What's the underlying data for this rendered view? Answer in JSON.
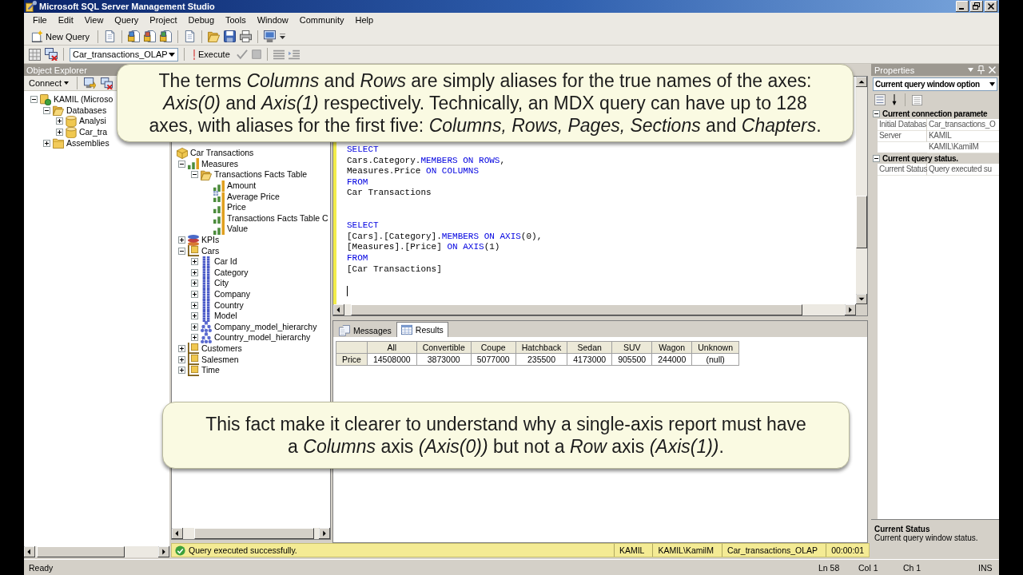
{
  "window": {
    "title": "Microsoft SQL Server Management Studio"
  },
  "menu": [
    "File",
    "Edit",
    "View",
    "Query",
    "Project",
    "Debug",
    "Tools",
    "Window",
    "Community",
    "Help"
  ],
  "toolbar": {
    "new_query": "New Query",
    "database": "Car_transactions_OLAP",
    "execute": "Execute"
  },
  "object_explorer": {
    "title": "Object Explorer",
    "connect": "Connect",
    "tree": [
      {
        "label": "KAMIL (Microso",
        "kind": "server",
        "expanded": true,
        "children": [
          {
            "label": "Databases",
            "kind": "folder",
            "expanded": true,
            "children": [
              {
                "label": "Analysi",
                "kind": "database",
                "expanded": false
              },
              {
                "label": "Car_tra",
                "kind": "database",
                "expanded": false
              }
            ]
          },
          {
            "label": "Assemblies",
            "kind": "folder",
            "expanded": false
          }
        ]
      }
    ]
  },
  "metadata": {
    "cube": "Car Transactions",
    "tree": [
      {
        "label": "Measures",
        "kind": "measures",
        "expanded": true,
        "children": [
          {
            "label": "Transactions Facts Table",
            "kind": "folder",
            "expanded": true,
            "children": [
              {
                "label": "Amount",
                "kind": "measure"
              },
              {
                "label": "Average Price",
                "kind": "calculated"
              },
              {
                "label": "Price",
                "kind": "measure"
              },
              {
                "label": "Transactions Facts Table C",
                "kind": "measure"
              },
              {
                "label": "Value",
                "kind": "measure"
              }
            ]
          }
        ]
      },
      {
        "label": "KPIs",
        "kind": "kpi",
        "expanded": false
      },
      {
        "label": "Cars",
        "kind": "dimension",
        "expanded": true,
        "children": [
          {
            "label": "Car Id",
            "kind": "attribute",
            "expanded": false
          },
          {
            "label": "Category",
            "kind": "attribute",
            "expanded": false
          },
          {
            "label": "City",
            "kind": "attribute",
            "expanded": false
          },
          {
            "label": "Company",
            "kind": "attribute",
            "expanded": false
          },
          {
            "label": "Country",
            "kind": "attribute",
            "expanded": false
          },
          {
            "label": "Model",
            "kind": "attribute",
            "expanded": false
          },
          {
            "label": "Company_model_hierarchy",
            "kind": "hierarchy",
            "expanded": false
          },
          {
            "label": "Country_model_hierarchy",
            "kind": "hierarchy",
            "expanded": false
          }
        ]
      },
      {
        "label": "Customers",
        "kind": "dimension",
        "expanded": false
      },
      {
        "label": "Salesmen",
        "kind": "dimension",
        "expanded": false
      },
      {
        "label": "Time",
        "kind": "dimension",
        "expanded": false
      }
    ]
  },
  "editor": {
    "queries": [
      {
        "lines": [
          [
            {
              "kind": "keyword",
              "text": "SELECT"
            }
          ],
          [
            {
              "kind": "plain",
              "text": "Cars.Category."
            },
            {
              "kind": "keyword",
              "text": "MEMBERS ON ROWS"
            },
            {
              "kind": "plain",
              "text": ","
            }
          ],
          [
            {
              "kind": "plain",
              "text": "Measures.Price "
            },
            {
              "kind": "keyword",
              "text": "ON COLUMNS"
            }
          ],
          [
            {
              "kind": "keyword",
              "text": "FROM"
            }
          ],
          [
            {
              "kind": "plain",
              "text": "Car Transactions"
            }
          ]
        ]
      },
      {
        "lines": [
          [
            {
              "kind": "keyword",
              "text": "SELECT"
            }
          ],
          [
            {
              "kind": "plain",
              "text": "[Cars].[Category]."
            },
            {
              "kind": "keyword",
              "text": "MEMBERS ON AXIS"
            },
            {
              "kind": "plain",
              "text": "(0),"
            }
          ],
          [
            {
              "kind": "plain",
              "text": "[Measures].[Price] "
            },
            {
              "kind": "keyword",
              "text": "ON AXIS"
            },
            {
              "kind": "plain",
              "text": "(1)"
            }
          ],
          [
            {
              "kind": "keyword",
              "text": "FROM"
            }
          ],
          [
            {
              "kind": "plain",
              "text": "[Car Transactions]"
            }
          ]
        ]
      }
    ]
  },
  "results": {
    "tabs": [
      {
        "label": "Messages",
        "kind": "messages",
        "selected": false
      },
      {
        "label": "Results",
        "kind": "grid",
        "selected": true
      }
    ],
    "columns": [
      "All",
      "Convertible",
      "Coupe",
      "Hatchback",
      "Sedan",
      "SUV",
      "Wagon",
      "Unknown"
    ],
    "rows": [
      {
        "header": "Price",
        "cells": [
          "14508000",
          "3873000",
          "5077000",
          "235500",
          "4173000",
          "905500",
          "244000",
          "(null)"
        ]
      }
    ]
  },
  "query_status": {
    "message": "Query executed successfully.",
    "cells": [
      "KAMIL",
      "KAMIL\\KamilM",
      "Car_transactions_OLAP",
      "00:00:01"
    ]
  },
  "properties": {
    "title": "Properties",
    "selector": "Current query window option",
    "sections": [
      {
        "label": "Current connection paramete",
        "expanded": true,
        "rows": [
          {
            "name": "Initial Databas",
            "value": "Car_transactions_O"
          },
          {
            "name": "Server",
            "value": "KAMIL"
          },
          {
            "value": "KAMIL\\KamilM"
          }
        ]
      },
      {
        "label": "Current query status.",
        "expanded": true,
        "rows": [
          {
            "name": "Current Status",
            "value": "Query executed su"
          }
        ]
      }
    ],
    "description": {
      "title": "Current Status",
      "text": "Current query window status."
    }
  },
  "status_bar": {
    "message": "Ready",
    "cells": [
      "Ln 58",
      "Col 1",
      "Ch 1",
      "INS"
    ]
  },
  "callouts": [
    {
      "text": "The terms *Columns* and *Rows* are simply aliases for the true names of the axes:\n*Axis(0)* and *Axis(1)* respectively. Technically, an MDX query can have up to 128\naxes, with aliases for the first five: *Columns, Rows, Pages, Sections* and *Chapters*."
    },
    {
      "text": "This fact make it clearer to understand why a single-axis report must have\na *Columns* axis *(Axis(0))* but not a *Row* axis *(Axis(1))*."
    }
  ]
}
